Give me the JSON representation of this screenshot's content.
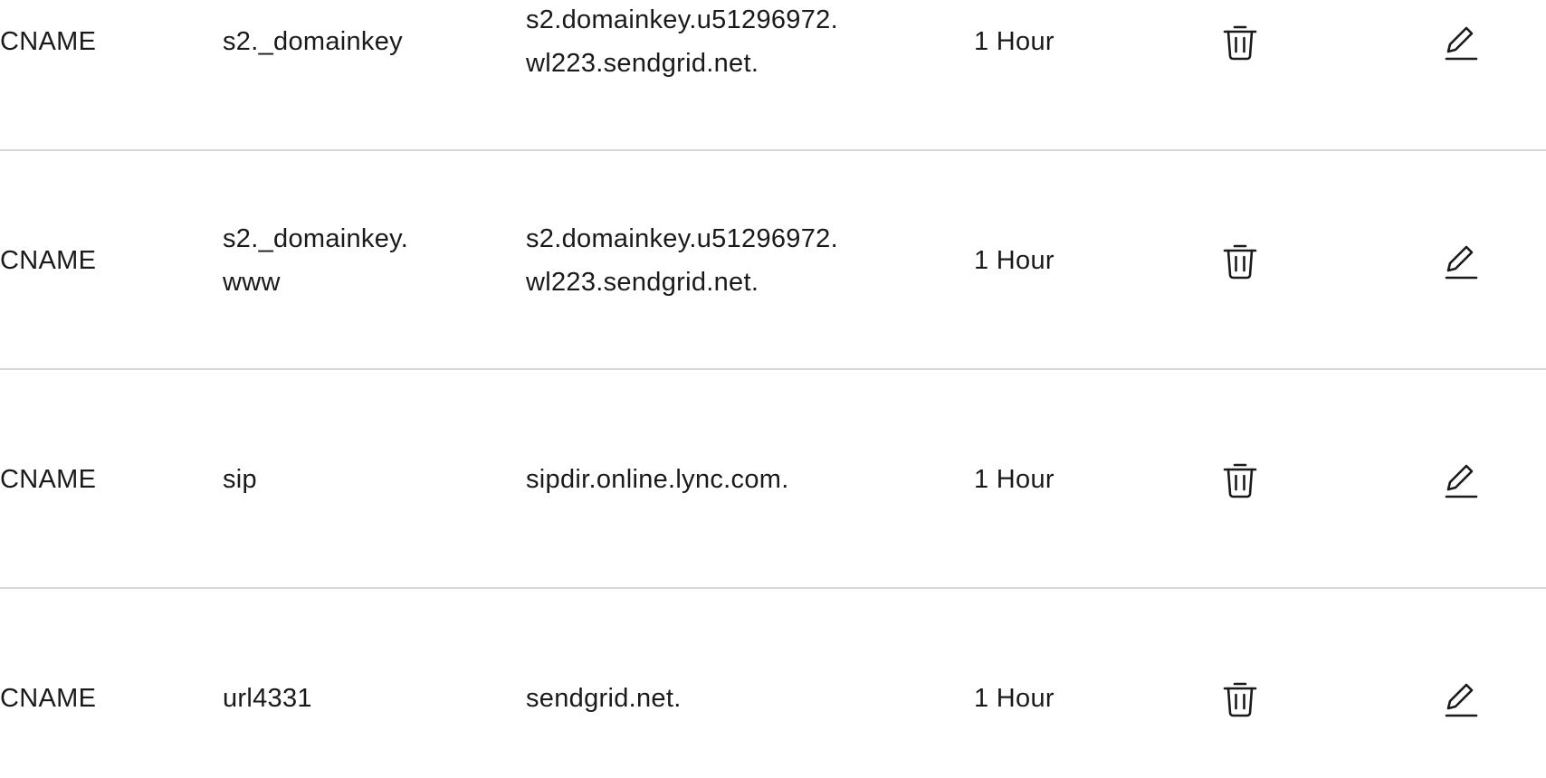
{
  "records": [
    {
      "type": "CNAME",
      "name": "s2._domainkey",
      "data": "s2.domainkey.u51296972.wl223.sendgrid.net.",
      "ttl": "1 Hour"
    },
    {
      "type": "CNAME",
      "name": "s2._domainkey.www",
      "data": "s2.domainkey.u51296972.wl223.sendgrid.net.",
      "ttl": "1 Hour"
    },
    {
      "type": "CNAME",
      "name": "sip",
      "data": "sipdir.online.lync.com.",
      "ttl": "1 Hour"
    },
    {
      "type": "CNAME",
      "name": "url4331",
      "data": "sendgrid.net.",
      "ttl": "1 Hour"
    }
  ],
  "icons": {
    "delete": "trash-icon",
    "edit": "pencil-icon"
  },
  "colors": {
    "text": "#1a1a1a",
    "divider": "#d6d6d6"
  }
}
